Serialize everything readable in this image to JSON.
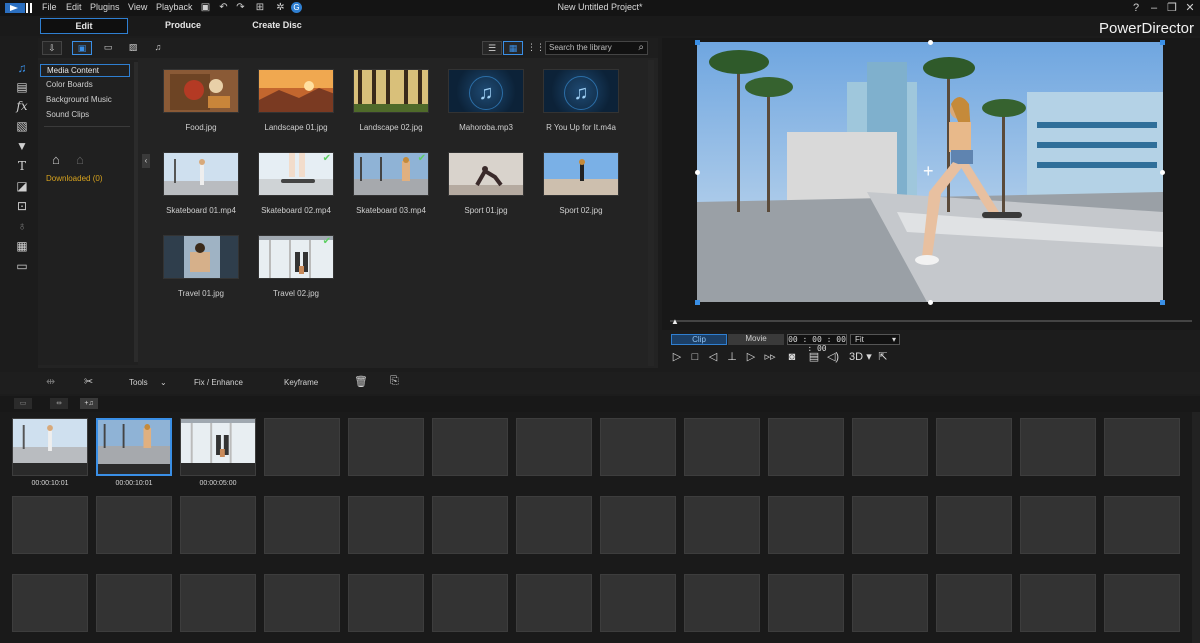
{
  "menu": {
    "items": [
      "File",
      "Edit",
      "Plugins",
      "View",
      "Playback"
    ],
    "title": "New Untitled Project*",
    "brand": "PowerDirector"
  },
  "modes": [
    "Edit",
    "Produce",
    "Create Disc"
  ],
  "library": {
    "search_placeholder": "Search the library",
    "categories": [
      "Media Content",
      "Color Boards",
      "Background Music",
      "Sound Clips"
    ],
    "downloaded": "Downloaded  (0)",
    "media": [
      {
        "name": "Food.jpg",
        "kind": "food",
        "used": false
      },
      {
        "name": "Landscape 01.jpg",
        "kind": "landscape1",
        "used": false
      },
      {
        "name": "Landscape 02.jpg",
        "kind": "forest",
        "used": false
      },
      {
        "name": "Mahoroba.mp3",
        "kind": "audio",
        "used": false
      },
      {
        "name": "R You Up for It.m4a",
        "kind": "audio",
        "used": false
      },
      {
        "name": "Skateboard 01.mp4",
        "kind": "skate1",
        "used": false
      },
      {
        "name": "Skateboard 02.mp4",
        "kind": "skate2",
        "used": true
      },
      {
        "name": "Skateboard 03.mp4",
        "kind": "skate3",
        "used": true
      },
      {
        "name": "Sport 01.jpg",
        "kind": "sport1",
        "used": false
      },
      {
        "name": "Sport 02.jpg",
        "kind": "sport2",
        "used": false
      },
      {
        "name": "Travel 01.jpg",
        "kind": "travel1",
        "used": false
      },
      {
        "name": "Travel 02.jpg",
        "kind": "travel2",
        "used": true
      }
    ]
  },
  "preview": {
    "clip_label": "Clip",
    "movie_label": "Movie",
    "timecode": "00 : 00 : 00 : 00",
    "fit_label": "Fit",
    "three_d": "3D"
  },
  "timeline_toolbar": {
    "tools": "Tools",
    "fix_enhance": "Fix / Enhance",
    "keyframe": "Keyframe"
  },
  "storyboard": {
    "clips": [
      {
        "time": "00:00:10:01",
        "kind": "skate1"
      },
      {
        "time": "00:00:10:01",
        "kind": "skate3"
      },
      {
        "time": "00:00:05:00",
        "kind": "travel2"
      }
    ]
  }
}
